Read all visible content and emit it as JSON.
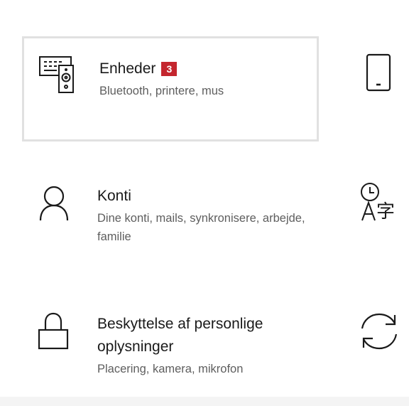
{
  "tiles": [
    {
      "title": "Enheder",
      "badge": "3",
      "description": "Bluetooth, printere, mus",
      "icon": "devices-icon"
    },
    {
      "title": "Konti",
      "description": "Dine konti, mails, synkronisere, arbejde, familie",
      "icon": "person-icon"
    },
    {
      "title": "Beskyttelse af personlige oplysninger",
      "description": "Placering, kamera, mikrofon",
      "icon": "lock-icon"
    }
  ],
  "right_column": [
    {
      "icon": "phone-icon"
    },
    {
      "icon": "time-language-icon"
    },
    {
      "icon": "update-sync-icon"
    }
  ],
  "colors": {
    "badge": "#c4262e",
    "selection_border": "#e1e1e1",
    "title_text": "#1a1a1a",
    "description_text": "#5e5e5e"
  }
}
